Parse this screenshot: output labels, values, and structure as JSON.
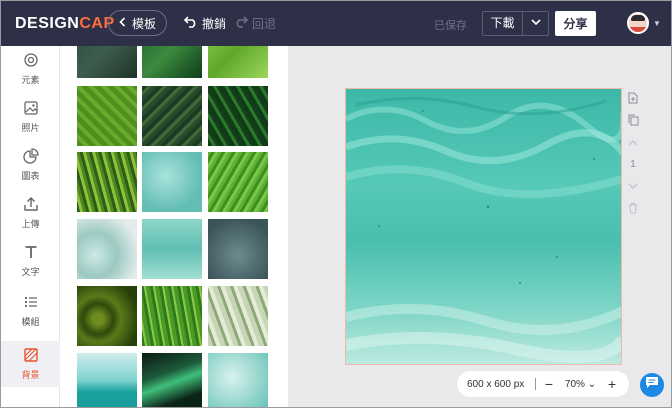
{
  "app": {
    "logo_main": "DESIGN",
    "logo_accent": "CAP"
  },
  "toolbar": {
    "back_label": "模板",
    "undo_label": "撤銷",
    "redo_label": "回退",
    "saved_label": "已保存",
    "download_label": "下載",
    "share_label": "分享"
  },
  "rail": {
    "items": [
      {
        "label": "元素",
        "icon": "shapes-icon"
      },
      {
        "label": "照片",
        "icon": "image-icon"
      },
      {
        "label": "圖表",
        "icon": "pie-chart-icon"
      },
      {
        "label": "上傳",
        "icon": "upload-icon"
      },
      {
        "label": "文字",
        "icon": "text-icon"
      },
      {
        "label": "模組",
        "icon": "list-icon"
      },
      {
        "label": "背景",
        "icon": "background-icon"
      }
    ],
    "active_index": 6
  },
  "canvas": {
    "size_label": "600 x 600 px",
    "zoom_label": "70%",
    "page_number": "1"
  },
  "colors": {
    "topbar": "#2e3048",
    "accent": "#e8532f",
    "canvas_bg": "#e9e9ec",
    "chat": "#1e88e5"
  }
}
